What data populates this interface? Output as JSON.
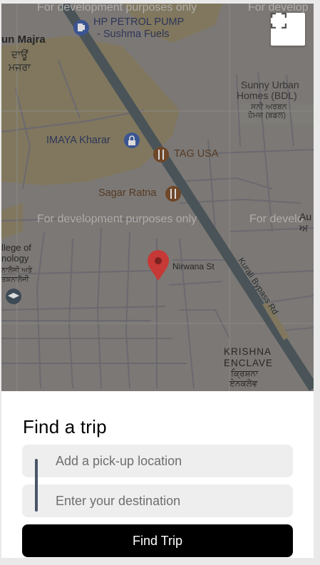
{
  "map": {
    "labels": {
      "dev_top_left": "For development purposes only",
      "dev_top_right": "For develop",
      "dev_mid_left": "For development purposes only",
      "dev_mid_right": "For develo",
      "hp_petrol_1": "HP PETROL PUMP",
      "hp_petrol_2": "- Sushma Fuels",
      "majra_1": "un Majra",
      "majra_2": "ਦਾਊਂ",
      "majra_3": "ਮਜਰਾ",
      "sunny_1": "Sunny Urban",
      "sunny_2": "Homes (BDL)",
      "sunny_3": "ਸਨੀ ਅਰਬਨ",
      "sunny_4": "ਹੋਮਜ਼ (ਬਡਲ)",
      "imaya": "IMAYA Kharar",
      "tag_usa": "TAG USA",
      "sagar": "Sagar Ratna",
      "college_1": "llege of",
      "college_2": "nology",
      "college_3": "ਨਾਲੋਜੀ ਅਤੇ",
      "college_4": "ਤਕਨਾਲੋਜੀ",
      "nirwana": "Nirwana St",
      "kurali": "Kurali Bypass Rd",
      "krishna_1": "KRISHNA",
      "krishna_2": "ENCLAVE",
      "krishna_3": "ਕ੍ਰਿਸ਼ਨਾ",
      "krishna_4": "ਏਨਕਲੇਵ",
      "au_1": "Au",
      "au_2": "ਅ"
    },
    "colors": {
      "base": "#8a8682",
      "yellow": "#8f8466",
      "road": "#4d5a5e",
      "pin": "#e53935"
    }
  },
  "panel": {
    "title": "Find a trip",
    "pickup_placeholder": "Add a pick-up location",
    "destination_placeholder": "Enter your destination",
    "find_button": "Find Trip"
  }
}
